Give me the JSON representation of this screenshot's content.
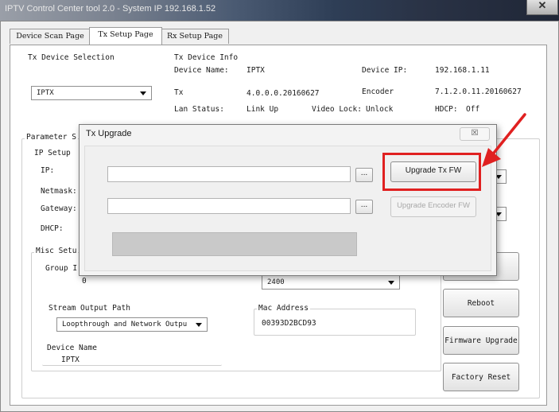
{
  "window": {
    "title": "IPTV Control Center tool 2.0 - System IP 192.168.1.52",
    "close_label": "✕"
  },
  "tabs": [
    {
      "label": "Device Scan Page"
    },
    {
      "label": "Tx Setup Page",
      "active": true
    },
    {
      "label": "Rx Setup Page"
    }
  ],
  "tx_selection": {
    "label": "Tx Device Selection",
    "selected": "IPTX"
  },
  "tx_info": {
    "title": "Tx Device Info",
    "device_name_label": "Device Name:",
    "device_name": "IPTX",
    "device_ip_label": "Device IP:",
    "device_ip": "192.168.1.11",
    "tx_label": "Tx",
    "tx_version": "4.0.0.0.20160627",
    "encoder_label": "Encoder",
    "encoder_version": "7.1.2.0.11.20160627",
    "lan_status_label": "Lan Status:",
    "lan_status": "Link Up",
    "video_lock_label": "Video Lock:",
    "video_lock": "Unlock",
    "hdcp_label": "HDCP:",
    "hdcp": "Off"
  },
  "parameter": {
    "title_partial": "Parameter S",
    "ip_setup": "IP Setup",
    "ip_label": "IP:",
    "netmask_label": "Netmask:",
    "gateway_label": "Gateway:",
    "dhcp_label": "DHCP:",
    "misc_setup": "Misc Setu",
    "group_id_label": "Group I",
    "group_id_value": "0",
    "bitrate_value": "2400",
    "stream_output_label": "Stream Output Path",
    "stream_output_value": "Loopthrough and Network Outpu",
    "mac_label": "Mac Address",
    "mac_value": "00393D2BCD93",
    "device_name_label": "Device Name",
    "device_name_value": "IPTX"
  },
  "side_buttons": {
    "reboot": "Reboot",
    "firmware_upgrade": "Firmware Upgrade",
    "factory_reset": "Factory Reset"
  },
  "dialog": {
    "title": "Tx Upgrade",
    "close_label": "☒",
    "browse_label": "...",
    "upgrade_tx_fw": "Upgrade Tx FW",
    "upgrade_encoder_fw": "Upgrade Encoder FW",
    "tx_fw_path": "",
    "encoder_fw_path": "",
    "progress": 0
  },
  "colors": {
    "highlight": "#e02020",
    "arrow": "#e02020"
  }
}
